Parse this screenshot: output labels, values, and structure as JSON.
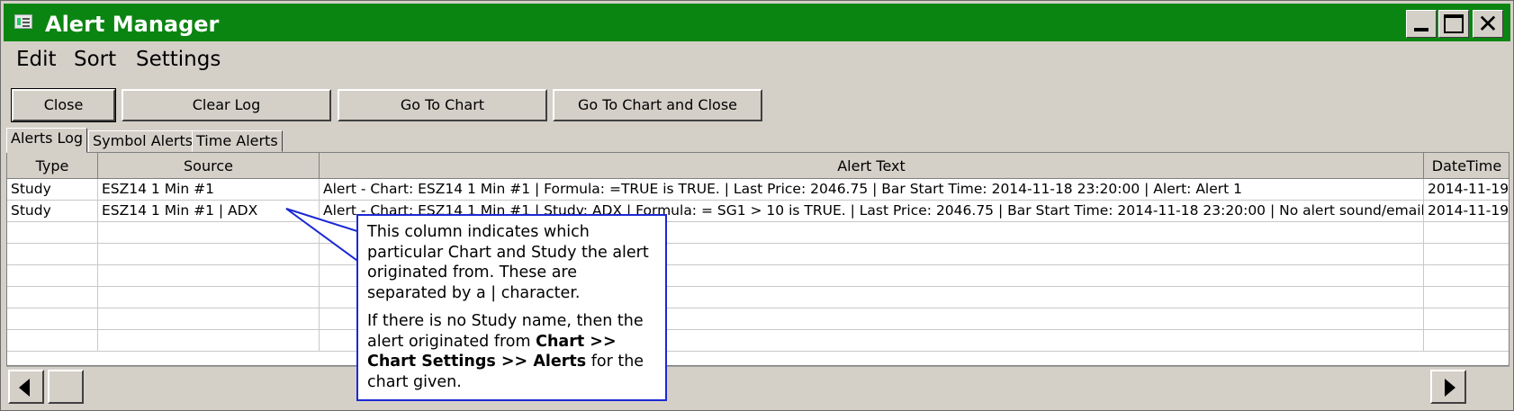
{
  "window": {
    "title": "Alert Manager",
    "accent_color": "#0b8511",
    "controls": [
      "minimize-icon",
      "maximize-icon",
      "close-icon"
    ],
    "close_glyph": "✕"
  },
  "menu": {
    "items": [
      "Edit",
      "Sort",
      "Settings"
    ]
  },
  "toolbar": {
    "buttons": [
      "Close",
      "Clear Log",
      "Go To Chart",
      "Go To Chart and Close"
    ]
  },
  "tabs": {
    "items": [
      "Alerts Log",
      "Symbol Alerts",
      "Time Alerts"
    ],
    "active": "Alerts Log"
  },
  "table": {
    "columns": [
      "Type",
      "Source",
      "Alert Text",
      "DateTime"
    ],
    "rows": [
      {
        "type": "Study",
        "source": "ESZ14  1 Min   #1",
        "alert_text": "Alert - Chart: ESZ14  1 Min   #1 | Formula: =TRUE is TRUE. | Last Price: 2046.75 | Bar Start Time: 2014-11-18  23:20:00 | Alert: Alert 1",
        "datetime": "2014-11-19"
      },
      {
        "type": "Study",
        "source": "ESZ14  1 Min   #1 | ADX",
        "alert_text": "Alert - Chart: ESZ14  1 Min   #1 | Study: ADX | Formula: = SG1 > 10 is TRUE. | Last Price: 2046.75 | Bar Start Time: 2014-11-18  23:20:00 | No alert sound/email",
        "datetime": "2014-11-19"
      }
    ]
  },
  "callout": {
    "p1": "This column indicates which particular Chart and Study the alert originated from. These are separated by a | character.",
    "p2_a": "If there is no Study name, then the alert originated from ",
    "p2_b": "Chart >> Chart Settings >> Alerts",
    "p2_c": " for the chart given.",
    "border_color": "#1c29d4"
  }
}
